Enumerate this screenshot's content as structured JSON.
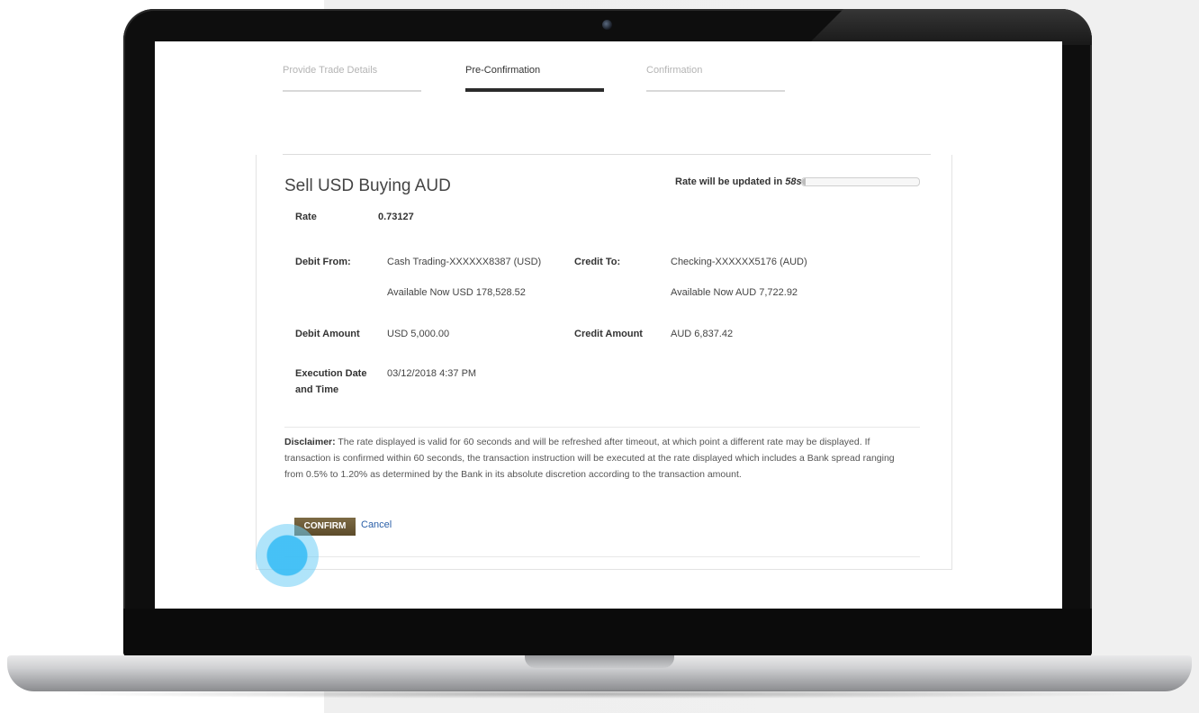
{
  "steps": [
    {
      "label": "Provide Trade Details"
    },
    {
      "label": "Pre-Confirmation"
    },
    {
      "label": "Confirmation"
    }
  ],
  "trade": {
    "title": "Sell USD Buying AUD",
    "rate_timer_label": "Rate will be updated in",
    "rate_timer_seconds": "58s",
    "timer_progress": 0.03,
    "rate_label": "Rate",
    "rate_value": "0.73127",
    "debit_from_label": "Debit From:",
    "debit_from_account": "Cash Trading-XXXXXX8387 (USD)",
    "debit_from_available": "Available Now USD 178,528.52",
    "credit_to_label": "Credit To:",
    "credit_to_account": "Checking-XXXXXX5176 (AUD)",
    "credit_to_available": "Available Now AUD 7,722.92",
    "debit_amount_label": "Debit Amount",
    "debit_amount_value": "USD 5,000.00",
    "credit_amount_label": "Credit Amount",
    "credit_amount_value": "AUD 6,837.42",
    "execution_label": "Execution Date and Time",
    "execution_value": "03/12/2018 4:37 PM"
  },
  "disclaimer": {
    "heading": "Disclaimer:",
    "text": "The rate displayed is valid for 60 seconds and will be refreshed after timeout, at which point a different rate may be displayed. If transaction is confirmed within 60 seconds, the transaction instruction will be executed at the rate displayed which includes a Bank spread ranging from 0.5% to 1.20% as determined by the Bank in its absolute discretion according to the transaction amount."
  },
  "actions": {
    "confirm_label": "CONFIRM",
    "cancel_label": "Cancel"
  },
  "colors": {
    "confirm_button": "#6b5a36",
    "link": "#2a5fa8",
    "touch_indicator": "#3cbef5"
  }
}
